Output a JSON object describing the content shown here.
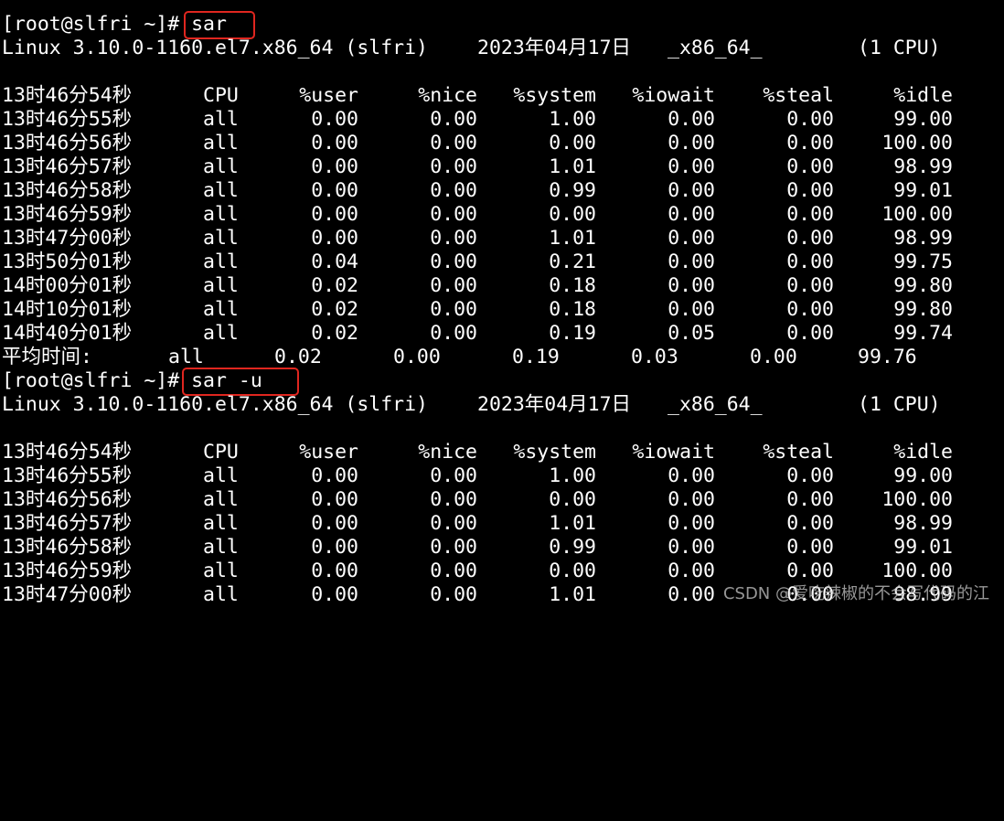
{
  "colors": {
    "background": "#000000",
    "text": "#ffffff",
    "highlight_box": "#e0261f"
  },
  "blocks": [
    {
      "prompt": "[root@slfri ~]# ",
      "command": "sar",
      "sysinfo": {
        "kernel": "Linux 3.10.0-1160.el7.x86_64 (slfri)",
        "date": "2023年04月17日",
        "arch": "_x86_64_",
        "cpus": "(1 CPU)"
      },
      "header": [
        "13时46分54秒",
        "CPU",
        "%user",
        "%nice",
        "%system",
        "%iowait",
        "%steal",
        "%idle"
      ],
      "rows": [
        [
          "13时46分55秒",
          "all",
          "0.00",
          "0.00",
          "1.00",
          "0.00",
          "0.00",
          "99.00"
        ],
        [
          "13时46分56秒",
          "all",
          "0.00",
          "0.00",
          "0.00",
          "0.00",
          "0.00",
          "100.00"
        ],
        [
          "13时46分57秒",
          "all",
          "0.00",
          "0.00",
          "1.01",
          "0.00",
          "0.00",
          "98.99"
        ],
        [
          "13时46分58秒",
          "all",
          "0.00",
          "0.00",
          "0.99",
          "0.00",
          "0.00",
          "99.01"
        ],
        [
          "13时46分59秒",
          "all",
          "0.00",
          "0.00",
          "0.00",
          "0.00",
          "0.00",
          "100.00"
        ],
        [
          "13时47分00秒",
          "all",
          "0.00",
          "0.00",
          "1.01",
          "0.00",
          "0.00",
          "98.99"
        ],
        [
          "13时50分01秒",
          "all",
          "0.04",
          "0.00",
          "0.21",
          "0.00",
          "0.00",
          "99.75"
        ],
        [
          "14时00分01秒",
          "all",
          "0.02",
          "0.00",
          "0.18",
          "0.00",
          "0.00",
          "99.80"
        ],
        [
          "14时10分01秒",
          "all",
          "0.02",
          "0.00",
          "0.18",
          "0.00",
          "0.00",
          "99.80"
        ],
        [
          "14时40分01秒",
          "all",
          "0.02",
          "0.00",
          "0.19",
          "0.05",
          "0.00",
          "99.74"
        ]
      ],
      "summary": [
        "平均时间:",
        "all",
        "0.02",
        "0.00",
        "0.19",
        "0.03",
        "0.00",
        "99.76"
      ]
    },
    {
      "prompt": "[root@slfri ~]# ",
      "command": "sar -u",
      "sysinfo": {
        "kernel": "Linux 3.10.0-1160.el7.x86_64 (slfri)",
        "date": "2023年04月17日",
        "arch": "_x86_64_",
        "cpus": "(1 CPU)"
      },
      "header": [
        "13时46分54秒",
        "CPU",
        "%user",
        "%nice",
        "%system",
        "%iowait",
        "%steal",
        "%idle"
      ],
      "rows": [
        [
          "13时46分55秒",
          "all",
          "0.00",
          "0.00",
          "1.00",
          "0.00",
          "0.00",
          "99.00"
        ],
        [
          "13时46分56秒",
          "all",
          "0.00",
          "0.00",
          "0.00",
          "0.00",
          "0.00",
          "100.00"
        ],
        [
          "13时46分57秒",
          "all",
          "0.00",
          "0.00",
          "1.01",
          "0.00",
          "0.00",
          "98.99"
        ],
        [
          "13时46分58秒",
          "all",
          "0.00",
          "0.00",
          "0.99",
          "0.00",
          "0.00",
          "99.01"
        ],
        [
          "13时46分59秒",
          "all",
          "0.00",
          "0.00",
          "0.00",
          "0.00",
          "0.00",
          "100.00"
        ],
        [
          "13时47分00秒",
          "all",
          "0.00",
          "0.00",
          "1.01",
          "0.00",
          "0.00",
          "98.99"
        ]
      ]
    }
  ],
  "watermark": "CSDN @爱吃辣椒的不会写代码的江"
}
